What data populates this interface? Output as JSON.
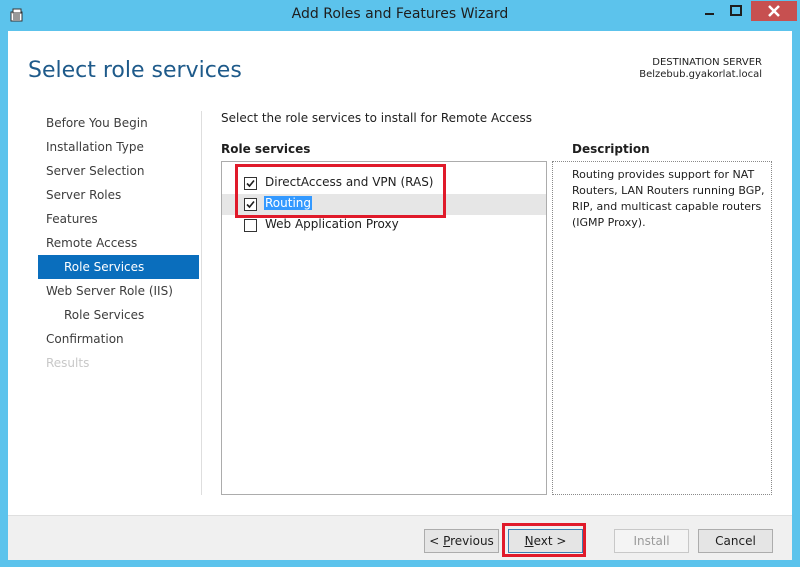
{
  "window": {
    "title": "Add Roles and Features Wizard",
    "titlebar_color": "#5cc3ec",
    "close_color": "#c75050"
  },
  "header": {
    "page_title": "Select role services",
    "destination_label": "DESTINATION SERVER",
    "destination_server": "Belzebub.gyakorlat.local"
  },
  "nav": {
    "items": [
      {
        "label": "Before You Begin",
        "state": "normal"
      },
      {
        "label": "Installation Type",
        "state": "normal"
      },
      {
        "label": "Server Selection",
        "state": "normal"
      },
      {
        "label": "Server Roles",
        "state": "normal"
      },
      {
        "label": "Features",
        "state": "normal"
      },
      {
        "label": "Remote Access",
        "state": "normal"
      },
      {
        "label": "Role Services",
        "state": "active"
      },
      {
        "label": "Web Server Role (IIS)",
        "state": "normal"
      },
      {
        "label": "Role Services",
        "state": "normal"
      },
      {
        "label": "Confirmation",
        "state": "normal"
      },
      {
        "label": "Results",
        "state": "disabled"
      }
    ]
  },
  "main": {
    "instruction": "Select the role services to install for Remote Access",
    "role_services_header": "Role services",
    "role_services": [
      {
        "label": "DirectAccess and VPN (RAS)",
        "checked": true
      },
      {
        "label": "Routing",
        "checked": true,
        "selected": true
      },
      {
        "label": "Web Application Proxy",
        "checked": false
      }
    ],
    "description_header": "Description",
    "description_text": "Routing provides support for NAT Routers, LAN Routers running BGP, RIP, and multicast capable routers (IGMP Proxy)."
  },
  "buttons": {
    "previous_prefix": "< ",
    "previous_mnemonic": "P",
    "previous_rest": "revious",
    "next_mnemonic": "N",
    "next_rest": "ext >",
    "install": "Install",
    "cancel": "Cancel"
  },
  "colors": {
    "accent": "#0a6ebd",
    "highlight": "#e01a2a",
    "selection": "#3399ff"
  }
}
